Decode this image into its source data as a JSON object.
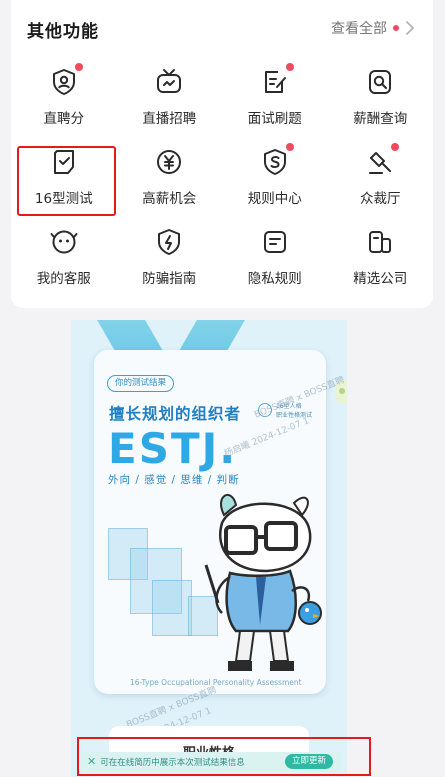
{
  "section": {
    "title": "其他功能",
    "view_all": "查看全部"
  },
  "features": [
    [
      {
        "label": "直聘分",
        "icon": "shield-person-icon",
        "dot": true
      },
      {
        "label": "直播招聘",
        "icon": "live-tv-icon",
        "dot": false
      },
      {
        "label": "面试刷题",
        "icon": "note-edit-icon",
        "dot": true
      },
      {
        "label": "薪酬查询",
        "icon": "search-doc-icon",
        "dot": false
      }
    ],
    [
      {
        "label": "16型测试",
        "icon": "check-doc-icon",
        "dot": false
      },
      {
        "label": "高薪机会",
        "icon": "yen-coin-icon",
        "dot": false
      },
      {
        "label": "规则中心",
        "icon": "shield-s-icon",
        "dot": true
      },
      {
        "label": "众裁厅",
        "icon": "gavel-icon",
        "dot": true
      }
    ],
    [
      {
        "label": "我的客服",
        "icon": "service-face-icon",
        "dot": false
      },
      {
        "label": "防骗指南",
        "icon": "shield-bolt-icon",
        "dot": false
      },
      {
        "label": "隐私规则",
        "icon": "privacy-doc-icon",
        "dot": false
      },
      {
        "label": "精选公司",
        "icon": "building-icon",
        "dot": false
      }
    ]
  ],
  "result": {
    "chip": "你的测试结果",
    "headline": "擅长规划的组织者",
    "badge_line1": "16型人格",
    "badge_line2": "职业性格测试",
    "type": "ESTJ.",
    "traits": "外向 / 感觉 / 思维 / 判断",
    "footer_en": "16-Type Occupational Personality Assessment",
    "watermark1": "BOSS直聘 x BOSS直聘",
    "watermark2": "杨启曦 2024-12-07 1",
    "watermark3": "BOSS直聘 x BOSS直聘",
    "watermark4": "杨启曦 2024-12-07 1",
    "below_title": "职业性格"
  },
  "notice": {
    "close": "✕",
    "text": "可在在线简历中展示本次测试结果信息",
    "button": "立即更新"
  },
  "colors": {
    "accent_red": "#f04a5d",
    "highlight_red": "#e21b1b",
    "mbti_blue": "#2fa9e6",
    "notice_green": "#2fb8a3"
  }
}
